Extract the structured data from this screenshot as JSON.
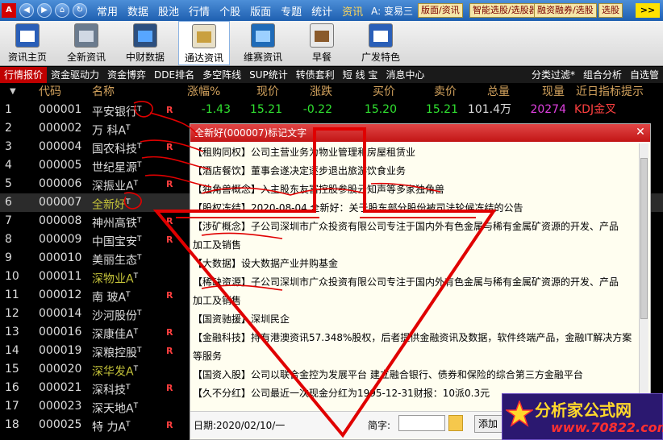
{
  "menu": {
    "items": [
      "常用",
      "数据",
      "股池",
      "行情",
      "个股",
      "版面",
      "专题",
      "统计",
      "资讯"
    ],
    "active_index": 8,
    "center_text": "A: 变易三",
    "right_tags": [
      "版面/资讯",
      "智能选股/选股器",
      "融资融券/选股",
      "选股"
    ],
    "more_label": ">>"
  },
  "toolbar": {
    "items": [
      {
        "label": "资讯主页",
        "icon": "calendar-icon"
      },
      {
        "label": "全新资讯",
        "icon": "hammer-icon"
      },
      {
        "label": "中财数据",
        "icon": "monitor-icon"
      },
      {
        "label": "通达资讯",
        "icon": "grid-icon"
      },
      {
        "label": "维赛资讯",
        "icon": "chart-icon"
      },
      {
        "label": "早餐",
        "icon": "coffee-icon"
      },
      {
        "label": "广发特色",
        "icon": "calendar-icon"
      }
    ],
    "selected_index": 3
  },
  "subbar": {
    "tabs": [
      "行情报价",
      "资金驱动力",
      "资金博弈",
      "DDE排名",
      "多空阵线",
      "SUP统计",
      "转债套利",
      "短 线 宝",
      "消息中心"
    ],
    "active_index": 0,
    "right": [
      "分类过滤*",
      "组合分析",
      "自选管"
    ]
  },
  "table": {
    "headers": [
      "代码",
      "名称",
      "涨幅%",
      "现价",
      "涨跌",
      "买价",
      "卖价",
      "总量",
      "现量",
      "近日指标提示"
    ],
    "sort_marker": "▼",
    "rows": [
      {
        "idx": "1",
        "code": "000001",
        "name": "平安银行",
        "flag": "R",
        "pct": "-1.43",
        "price": "15.21",
        "chg": "-0.22",
        "bid": "15.20",
        "ask": "15.21",
        "vol": "101.4万",
        "now": "20274",
        "ind": "KDJ金叉"
      },
      {
        "idx": "2",
        "code": "000002",
        "name": "万 科A",
        "flag": "",
        "pct": "",
        "price": "",
        "chg": "",
        "bid": "",
        "ask": "",
        "vol": "",
        "now": "",
        "ind": ""
      },
      {
        "idx": "3",
        "code": "000004",
        "name": "国农科技",
        "flag": "R",
        "pct": "",
        "price": "",
        "chg": "",
        "bid": "",
        "ask": "",
        "vol": "",
        "now": "",
        "ind": ""
      },
      {
        "idx": "4",
        "code": "000005",
        "name": "世纪星源",
        "flag": "",
        "pct": "",
        "price": "",
        "chg": "",
        "bid": "",
        "ask": "",
        "vol": "",
        "now": "",
        "ind": ""
      },
      {
        "idx": "5",
        "code": "000006",
        "name": "深振业A",
        "flag": "R",
        "pct": "",
        "price": "",
        "chg": "",
        "bid": "",
        "ask": "",
        "vol": "",
        "now": "",
        "ind": ""
      },
      {
        "idx": "6",
        "code": "000007",
        "name": "全新好",
        "flag": "",
        "pct": "",
        "price": "",
        "chg": "",
        "bid": "",
        "ask": "",
        "vol": "",
        "now": "",
        "ind": ""
      },
      {
        "idx": "7",
        "code": "000008",
        "name": "神州高铁",
        "flag": "R",
        "pct": "",
        "price": "",
        "chg": "",
        "bid": "",
        "ask": "",
        "vol": "",
        "now": "",
        "ind": ""
      },
      {
        "idx": "8",
        "code": "000009",
        "name": "中国宝安",
        "flag": "R",
        "pct": "",
        "price": "",
        "chg": "",
        "bid": "",
        "ask": "",
        "vol": "",
        "now": "",
        "ind": ""
      },
      {
        "idx": "9",
        "code": "000010",
        "name": "美丽生态",
        "flag": "",
        "pct": "",
        "price": "",
        "chg": "",
        "bid": "",
        "ask": "",
        "vol": "",
        "now": "",
        "ind": ""
      },
      {
        "idx": "10",
        "code": "000011",
        "name": "深物业A",
        "flag": "",
        "pct": "",
        "price": "",
        "chg": "",
        "bid": "",
        "ask": "",
        "vol": "",
        "now": "",
        "ind": ""
      },
      {
        "idx": "11",
        "code": "000012",
        "name": "南 玻A",
        "flag": "R",
        "pct": "",
        "price": "",
        "chg": "",
        "bid": "",
        "ask": "",
        "vol": "",
        "now": "",
        "ind": ""
      },
      {
        "idx": "12",
        "code": "000014",
        "name": "沙河股份",
        "flag": "",
        "pct": "",
        "price": "",
        "chg": "",
        "bid": "",
        "ask": "",
        "vol": "",
        "now": "",
        "ind": ""
      },
      {
        "idx": "13",
        "code": "000016",
        "name": "深康佳A",
        "flag": "R",
        "pct": "",
        "price": "",
        "chg": "",
        "bid": "",
        "ask": "",
        "vol": "",
        "now": "",
        "ind": ""
      },
      {
        "idx": "14",
        "code": "000019",
        "name": "深粮控股",
        "flag": "R",
        "pct": "",
        "price": "",
        "chg": "",
        "bid": "",
        "ask": "",
        "vol": "",
        "now": "",
        "ind": ""
      },
      {
        "idx": "15",
        "code": "000020",
        "name": "深华发A",
        "flag": "",
        "pct": "",
        "price": "",
        "chg": "",
        "bid": "",
        "ask": "",
        "vol": "",
        "now": "",
        "ind": ""
      },
      {
        "idx": "16",
        "code": "000021",
        "name": "深科技",
        "flag": "R",
        "pct": "",
        "price": "",
        "chg": "",
        "bid": "",
        "ask": "",
        "vol": "",
        "now": "",
        "ind": ""
      },
      {
        "idx": "17",
        "code": "000023",
        "name": "深天地A",
        "flag": "",
        "pct": "",
        "price": "",
        "chg": "",
        "bid": "",
        "ask": "",
        "vol": "",
        "now": "",
        "ind": ""
      },
      {
        "idx": "18",
        "code": "000025",
        "name": "特 力A",
        "flag": "R",
        "pct": "",
        "price": "",
        "chg": "",
        "bid": "",
        "ask": "",
        "vol": "",
        "now": "",
        "ind": ""
      }
    ],
    "selected_row": 5,
    "name_mark": "T"
  },
  "popup": {
    "title": "全新好(000007)标记文字",
    "close": "✕",
    "lines": [
      "【租购同权】公司主营业务为物业管理和房屋租赁业",
      "【酒店餐饮】董事会遂决定逐步退出旅游饮食业务",
      "【独角兽概念】入主股东友富控股参股云知声等多家独角兽",
      "【股权冻结】2020-08-04,全新好：关于股东部分股份被司法轮候冻结的公告",
      "【涉矿概念】子公司深圳市广众投资有限公司专注于国内外有色金属与稀有金属矿资源的开发、产品",
      "加工及销售",
      "【大数据】设大数据产业并购基金",
      "【稀缺资源】子公司深圳市广众投资有限公司专注于国内外有色金属与稀有金属矿资源的开发、产品",
      "加工及销售",
      "【国资驰援】深圳民企",
      "【金融科技】持有港澳资讯57.348%股权，后者提供金融资讯及数据，软件终端产品，金融IT解决方案",
      "等服务",
      "【国资入股】公司以联合金控为发展平台 建立融合银行、债券和保险的综合第三方金融平台",
      "【久不分红】公司最近一次现金分红为1995-12-31财报：10派0.3元"
    ],
    "footer": {
      "date": "日期:2020/02/10/一",
      "jianzi_label": "简字:",
      "add_label": "添加"
    }
  },
  "watermark": {
    "title": "分析家公式网",
    "url": "www.70822.com"
  },
  "colors": {
    "accent_red": "#c00000",
    "title_blue": "#1e5fb0",
    "header_gold": "#d2a25d",
    "down_green": "#30e030",
    "up_red": "#ff3e3e",
    "annotation_red": "#e00000"
  }
}
